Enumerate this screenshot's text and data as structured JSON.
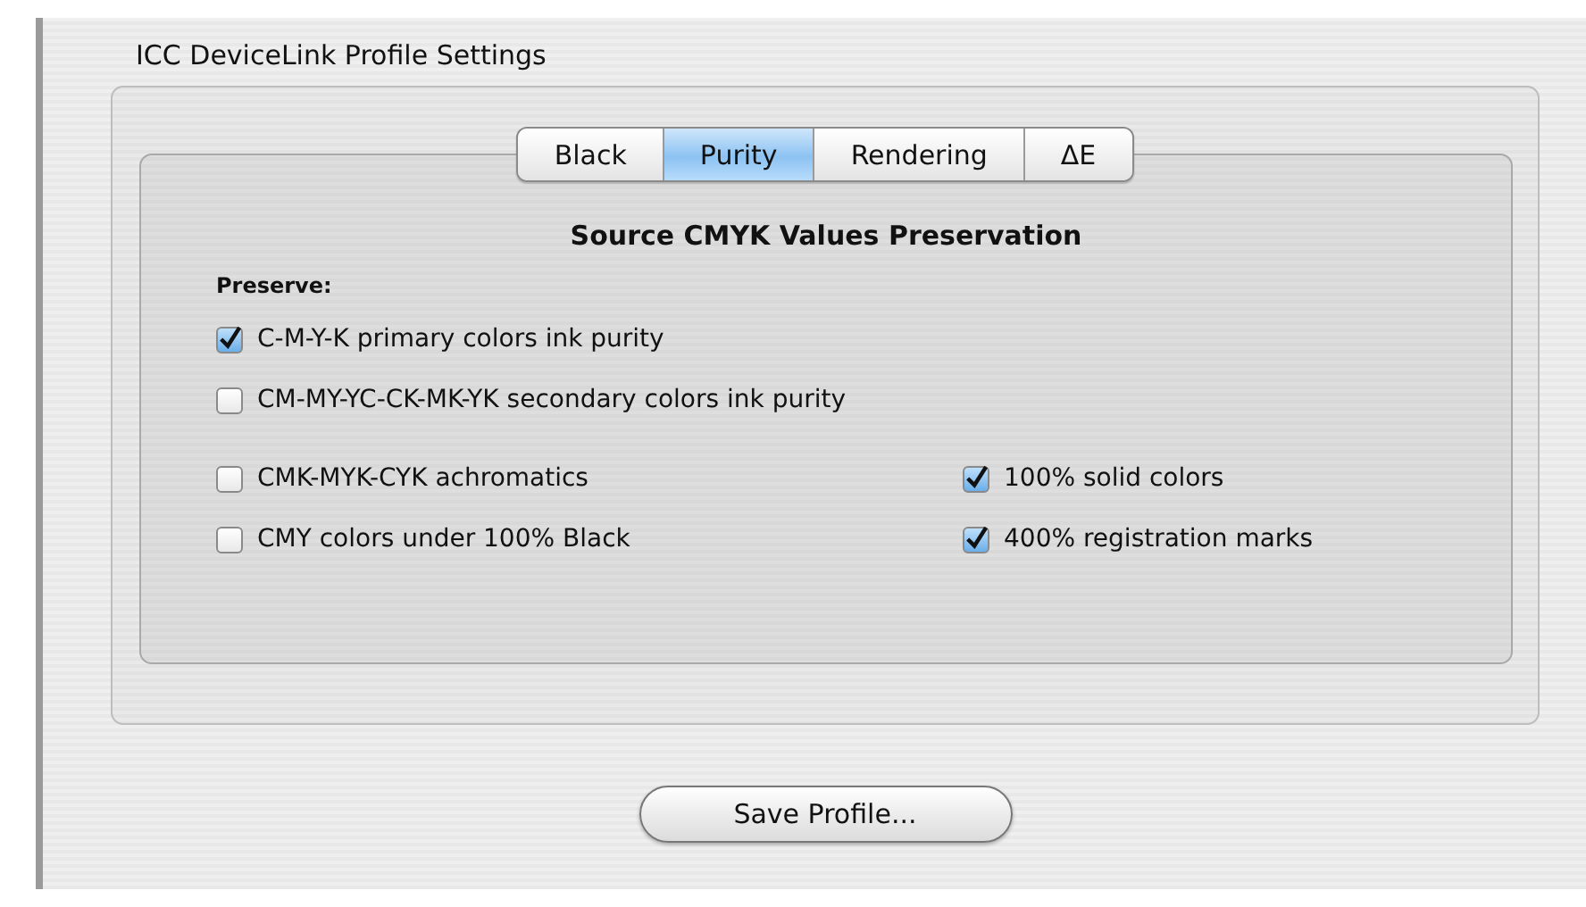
{
  "group_title": "ICC DeviceLink Profile Settings",
  "tabs": [
    {
      "label": "Black",
      "selected": false
    },
    {
      "label": "Purity",
      "selected": true
    },
    {
      "label": "Rendering",
      "selected": false
    },
    {
      "label": "ΔE",
      "selected": false
    }
  ],
  "heading": "Source CMYK Values Preservation",
  "preserve_label": "Preserve:",
  "options_full": [
    {
      "label": "C-M-Y-K primary colors ink purity",
      "checked": true
    },
    {
      "label": "CM-MY-YC-CK-MK-YK secondary colors ink purity",
      "checked": false
    }
  ],
  "options_left": [
    {
      "label": "CMK-MYK-CYK achromatics",
      "checked": false
    },
    {
      "label": "CMY colors under 100% Black",
      "checked": false
    }
  ],
  "options_right": [
    {
      "label": "100% solid colors",
      "checked": true
    },
    {
      "label": "400% registration marks",
      "checked": true
    }
  ],
  "save_button": "Save Profile..."
}
